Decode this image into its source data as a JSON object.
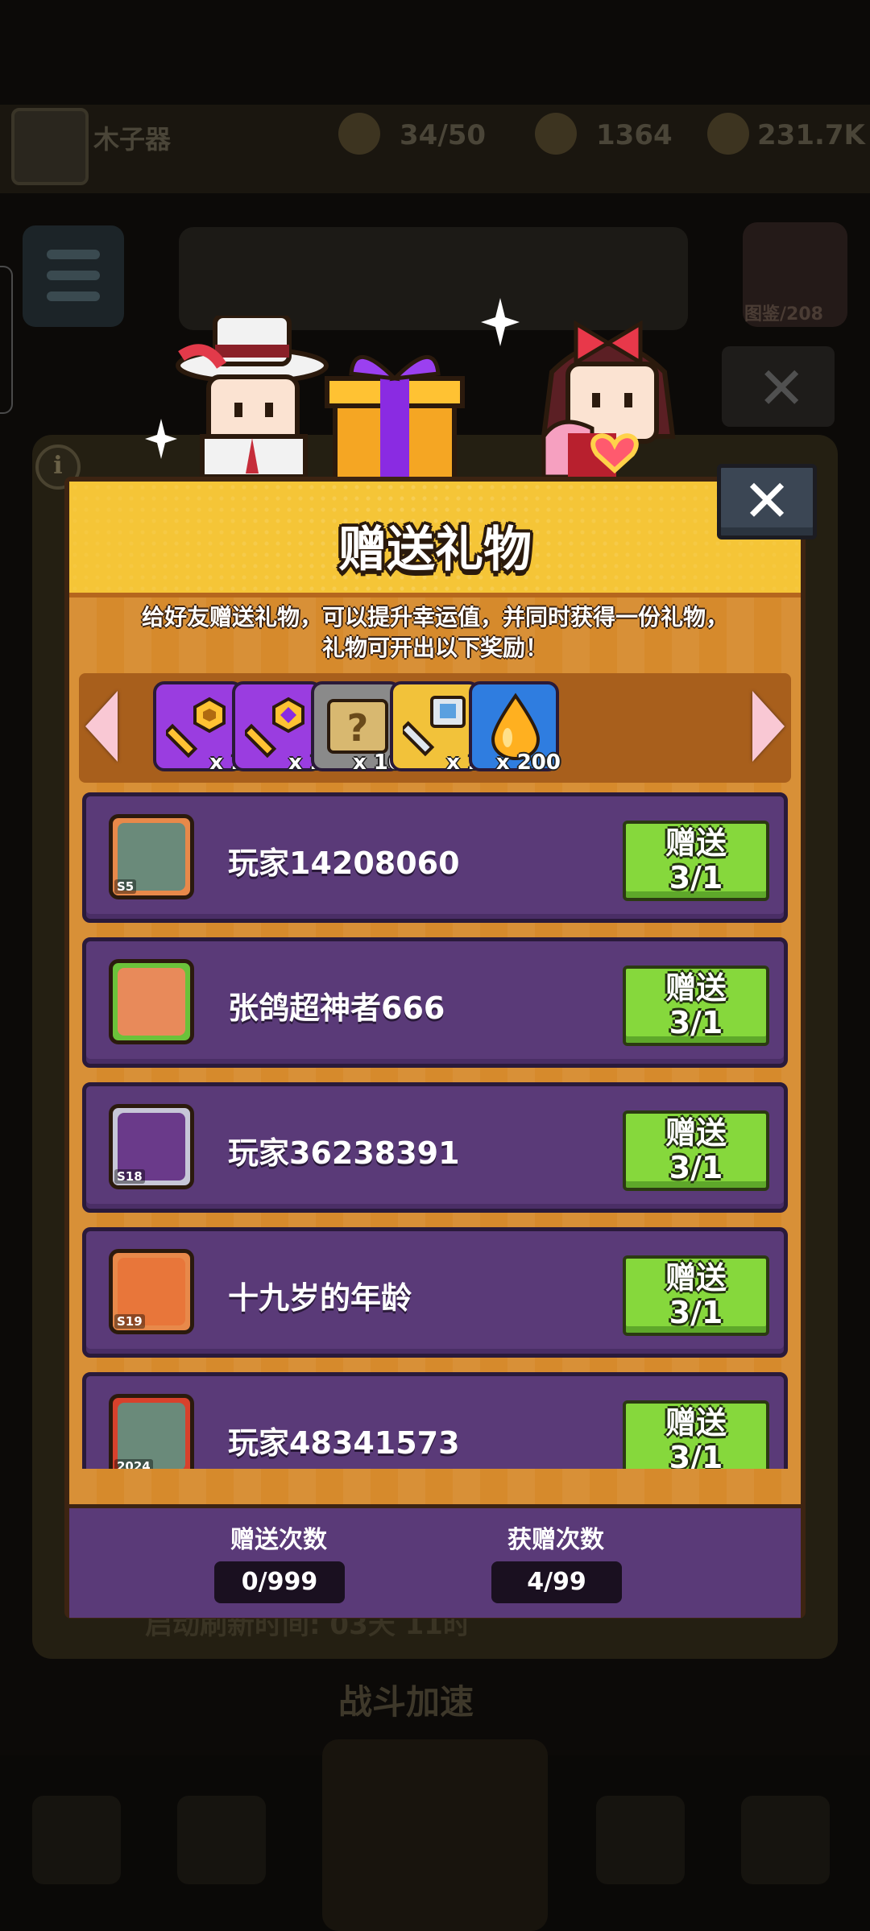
{
  "background": {
    "player_name": "木子器",
    "stat_energy": "34/50",
    "stat_gems": "1364",
    "stat_gold": "231.7K",
    "right_button_label": "图鉴/208",
    "bottom_text": "启动刷新时间: 03天 11时",
    "fight_text": "战斗加速"
  },
  "dialog": {
    "title": "赠送礼物",
    "description_line1": "给好友赠送礼物，可以提升幸运值，并同时获得一份礼物，",
    "description_line2": "礼物可开出以下奖励！",
    "close_label": "✕"
  },
  "rewards": [
    {
      "icon": "gold-key-hex-icon",
      "qty": "x 1",
      "bg": "#9a3de0"
    },
    {
      "icon": "gold-key-gem-icon",
      "qty": "x 1",
      "bg": "#9a3de0"
    },
    {
      "icon": "mystery-scroll-icon",
      "qty": "x 10",
      "bg": "#8a8a8a"
    },
    {
      "icon": "silver-key-icon",
      "qty": "x 1",
      "bg": "#f2c23a"
    },
    {
      "icon": "gold-drop-icon",
      "qty": "x 200",
      "bg": "#2f7de0"
    }
  ],
  "friends": [
    {
      "name": "玩家14208060",
      "level": "S5",
      "button_line1": "赠送",
      "button_line2": "3/1",
      "frame_color": "#e8894a"
    },
    {
      "name": "张鸽超神者666",
      "level": "",
      "button_line1": "赠送",
      "button_line2": "3/1",
      "frame_color": "#6bc23a"
    },
    {
      "name": "玩家36238391",
      "level": "S18",
      "button_line1": "赠送",
      "button_line2": "3/1",
      "frame_color": "#c7c7d8"
    },
    {
      "name": "十九岁的年龄",
      "level": "S19",
      "button_line1": "赠送",
      "button_line2": "3/1",
      "frame_color": "#e8894a"
    },
    {
      "name": "玩家48341573",
      "level": "2024",
      "button_line1": "赠送",
      "button_line2": "3/1",
      "frame_color": "#d8412c"
    }
  ],
  "footer": {
    "send_label": "赠送次数",
    "send_value": "0/999",
    "receive_label": "获赠次数",
    "receive_value": "4/99"
  },
  "colors": {
    "panel": "#d68a2c",
    "title_bar": "#f5c537",
    "row": "#5a3a78",
    "button_green": "#86d83c"
  }
}
